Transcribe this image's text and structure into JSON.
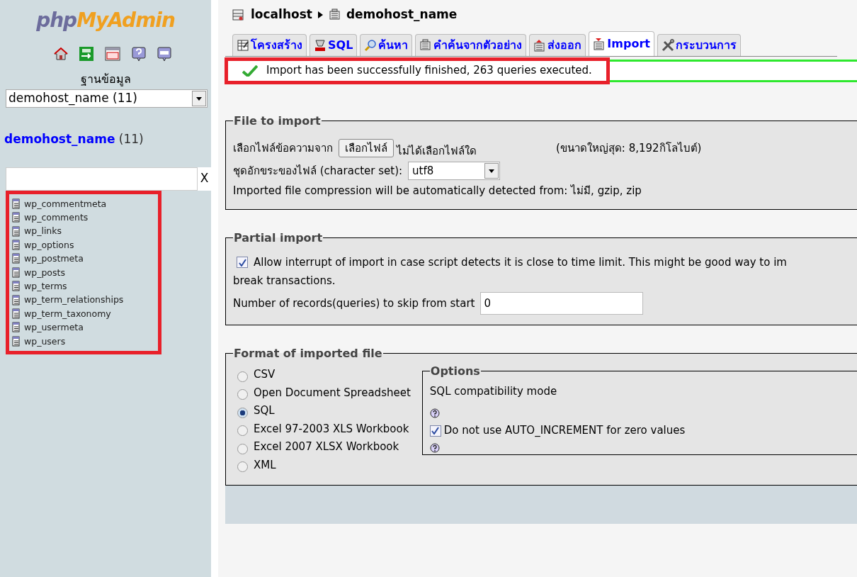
{
  "sidebar": {
    "logo_prefix": "php",
    "logo_name": "MyAdmin",
    "database_label": "ฐานข้อมูล",
    "database_select": {
      "value": "demohost_name (11)"
    },
    "database_link": {
      "name": "demohost_name",
      "count": "(11)"
    },
    "filter": {
      "clear": "X"
    },
    "tables": [
      "wp_commentmeta",
      "wp_comments",
      "wp_links",
      "wp_options",
      "wp_postmeta",
      "wp_posts",
      "wp_terms",
      "wp_term_relationships",
      "wp_term_taxonomy",
      "wp_usermeta",
      "wp_users"
    ]
  },
  "breadcrumb": [
    "localhost",
    "demohost_name"
  ],
  "tabs": [
    {
      "label": "โครงสร้าง",
      "selected": false
    },
    {
      "label": "SQL",
      "selected": false
    },
    {
      "label": "ค้นหา",
      "selected": false
    },
    {
      "label": "คำค้นจากตัวอย่าง",
      "selected": false
    },
    {
      "label": "ส่งออก",
      "selected": false
    },
    {
      "label": "Import",
      "selected": true
    },
    {
      "label": "กระบวนการ",
      "selected": false
    }
  ],
  "message": "Import has been successfully finished, 263 queries executed.",
  "file_to_import": {
    "legend": "File to import",
    "file_label": "เลือกไฟล์ข้อความจาก",
    "choose_button": "เลือกไฟล์",
    "no_file": "ไม่ได้เลือกไฟล์ใด",
    "max_size": "(ขนาดใหญ่สุด: 8,192กิโลไบต์)",
    "charset_label": "ชุดอักขระของไฟล์ (character set):",
    "charset_value": "utf8",
    "compression_note": "Imported file compression will be automatically detected from: ไม่มี, gzip, zip"
  },
  "partial_import": {
    "legend": "Partial import",
    "allow_interrupt": {
      "checked": true,
      "line_1": "Allow interrupt of import in case script detects it is close to time limit. This might be good way to im",
      "line_2": "break transactions."
    },
    "skip_label": "Number of records(queries) to skip from start",
    "skip_value": "0"
  },
  "format": {
    "legend": "Format of imported file",
    "options": [
      {
        "label": "CSV",
        "selected": false
      },
      {
        "label": "Open Document Spreadsheet",
        "selected": false
      },
      {
        "label": "SQL",
        "selected": true
      },
      {
        "label": "Excel 97-2003 XLS Workbook",
        "selected": false
      },
      {
        "label": "Excel 2007 XLSX Workbook",
        "selected": false
      },
      {
        "label": "XML",
        "selected": false
      }
    ],
    "options_box": {
      "legend": "Options",
      "compat_label": "SQL compatibility mode",
      "auto_increment": {
        "label": "Do not use AUTO_INCREMENT for zero values",
        "checked": true
      }
    }
  }
}
